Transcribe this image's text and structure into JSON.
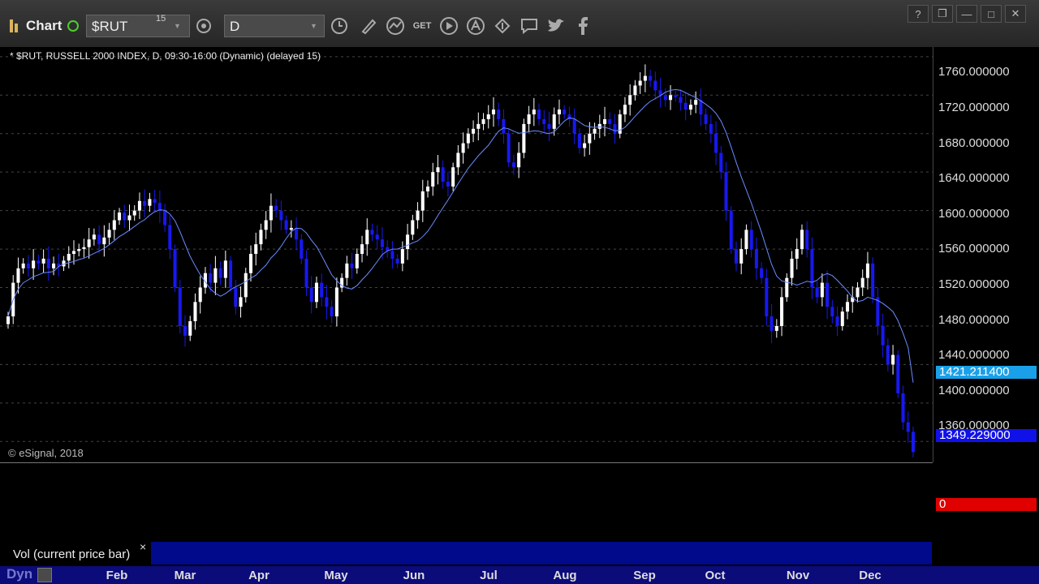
{
  "toolbar": {
    "title": "Chart",
    "symbol": "$RUT",
    "symbol_sup": "15",
    "interval": "D",
    "buttons": [
      "clock-icon",
      "pencil-icon",
      "line-tool-icon",
      "get-icon",
      "play-icon",
      "alert-icon",
      "link-icon",
      "chat-icon",
      "twitter-icon",
      "facebook-icon"
    ],
    "get_label": "GET",
    "window_controls": [
      "?",
      "❐",
      "—",
      "□",
      "✕"
    ]
  },
  "chart": {
    "header": "* $RUT, RUSSELL 2000 INDEX, D, 09:30-16:00 (Dynamic) (delayed 15)",
    "copyright": "© eSignal, 2018",
    "price_ticks": [
      "1760.000000",
      "1720.000000",
      "1680.000000",
      "1640.000000",
      "1600.000000",
      "1560.000000",
      "1520.000000",
      "1480.000000",
      "1440.000000",
      "1400.000000",
      "1360.000000"
    ],
    "ma_tag": "1421.211400",
    "last_tag": "1349.229000",
    "volume_tag": "0",
    "months": [
      "Feb",
      "Mar",
      "Apr",
      "May",
      "Jun",
      "Jul",
      "Aug",
      "Sep",
      "Oct",
      "Nov",
      "Dec"
    ]
  },
  "study": {
    "label": "Vol (current price bar)",
    "close": "×"
  },
  "footer": {
    "dyn": "Dyn"
  },
  "colors": {
    "up": "#ffffff",
    "down": "#1818f0",
    "ma": "#6a8cff",
    "grid": "#444444"
  },
  "chart_data": {
    "type": "candlestick",
    "ylim": [
      1340,
      1770
    ],
    "ma_last": 1421.2114,
    "last": 1349.229,
    "closes": [
      1490,
      1525,
      1540,
      1545,
      1540,
      1548,
      1545,
      1550,
      1540,
      1545,
      1542,
      1548,
      1555,
      1558,
      1560,
      1562,
      1570,
      1575,
      1565,
      1572,
      1580,
      1590,
      1598,
      1590,
      1595,
      1600,
      1610,
      1605,
      1612,
      1608,
      1600,
      1585,
      1560,
      1520,
      1480,
      1470,
      1485,
      1505,
      1520,
      1535,
      1525,
      1540,
      1530,
      1548,
      1520,
      1500,
      1510,
      1535,
      1555,
      1565,
      1580,
      1590,
      1605,
      1600,
      1590,
      1580,
      1582,
      1570,
      1550,
      1520,
      1505,
      1525,
      1510,
      1500,
      1490,
      1520,
      1530,
      1545,
      1540,
      1555,
      1565,
      1580,
      1575,
      1570,
      1562,
      1558,
      1550,
      1545,
      1560,
      1575,
      1590,
      1600,
      1620,
      1625,
      1640,
      1645,
      1630,
      1625,
      1645,
      1660,
      1670,
      1680,
      1685,
      1690,
      1695,
      1700,
      1705,
      1695,
      1680,
      1650,
      1645,
      1660,
      1690,
      1700,
      1705,
      1695,
      1690,
      1685,
      1700,
      1705,
      1700,
      1695,
      1680,
      1665,
      1670,
      1680,
      1685,
      1690,
      1695,
      1690,
      1680,
      1700,
      1710,
      1720,
      1730,
      1735,
      1740,
      1735,
      1725,
      1720,
      1715,
      1720,
      1718,
      1712,
      1705,
      1710,
      1715,
      1700,
      1690,
      1680,
      1660,
      1640,
      1600,
      1560,
      1545,
      1560,
      1580,
      1560,
      1540,
      1530,
      1490,
      1475,
      1480,
      1510,
      1530,
      1550,
      1560,
      1580,
      1560,
      1520,
      1510,
      1525,
      1500,
      1490,
      1480,
      1495,
      1505,
      1510,
      1520,
      1530,
      1545,
      1510,
      1480,
      1460,
      1440,
      1450,
      1410,
      1380,
      1370,
      1349
    ]
  }
}
